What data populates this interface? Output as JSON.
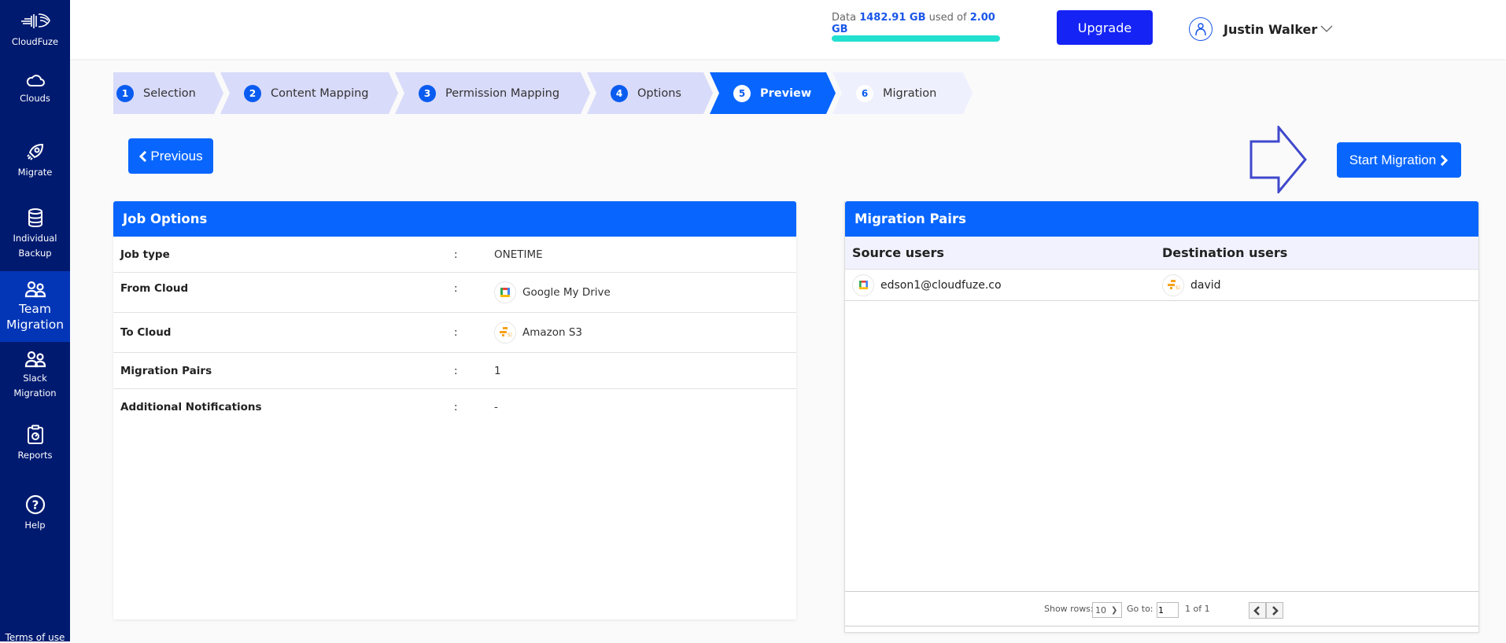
{
  "sidebar": {
    "brand": "CloudFuze",
    "items": [
      {
        "label": "Clouds",
        "icon": "cloud-icon"
      },
      {
        "label": "Migrate",
        "icon": "rocket-icon"
      },
      {
        "label_1": "Individual",
        "label_2": "Backup",
        "icon": "database-icon"
      },
      {
        "label_1": "Team",
        "label_2": "Migration",
        "icon": "users-icon",
        "active": true
      },
      {
        "label_1": "Slack",
        "label_2": "Migration",
        "icon": "users-icon"
      },
      {
        "label": "Reports",
        "icon": "clipboard-icon"
      },
      {
        "label": "Help",
        "icon": "help-icon"
      }
    ],
    "terms": "Terms of use"
  },
  "header": {
    "usage_prefix": "Data",
    "usage_used": "1482.91 GB",
    "usage_mid": "used of",
    "usage_total": "2.00 GB",
    "usage_percent": 100,
    "upgrade_label": "Upgrade",
    "user_name": "Justin Walker"
  },
  "stepper": {
    "steps": [
      {
        "num": "1",
        "label": "Selection",
        "state": "done"
      },
      {
        "num": "2",
        "label": "Content Mapping",
        "state": "done"
      },
      {
        "num": "3",
        "label": "Permission Mapping",
        "state": "done"
      },
      {
        "num": "4",
        "label": "Options",
        "state": "done"
      },
      {
        "num": "5",
        "label": "Preview",
        "state": "active"
      },
      {
        "num": "6",
        "label": "Migration",
        "state": "future"
      }
    ]
  },
  "actions": {
    "previous_label": "Previous",
    "start_label": "Start Migration"
  },
  "job_options": {
    "title": "Job Options",
    "rows": [
      {
        "key": "Job type",
        "value": "ONETIME"
      },
      {
        "key": "From Cloud",
        "value": "Google My Drive",
        "icon": "google-drive-icon"
      },
      {
        "key": "To Cloud",
        "value": "Amazon S3",
        "icon": "amazon-s3-icon"
      },
      {
        "key": "Migration Pairs",
        "value": "1"
      },
      {
        "key": "Additional Notifications",
        "value": "-"
      }
    ],
    "separator": ":"
  },
  "migration_pairs": {
    "title": "Migration Pairs",
    "columns": [
      "Source users",
      "Destination users"
    ],
    "rows": [
      {
        "source": "edson1@cloudfuze.co",
        "destination": "david"
      }
    ],
    "footer": {
      "show_rows_label": "Show rows:",
      "rows_value": "10",
      "goto_label": "Go to:",
      "goto_value": "1",
      "page_info": "1 of 1"
    }
  },
  "colors": {
    "sidebar_bg": "#001a70",
    "sidebar_active": "#0336b6",
    "primary": "#0866ff",
    "upgrade": "#1524f5",
    "step_done": "#d9dbfa",
    "step_future": "#eef0fd",
    "usage_bar": "#22e0d0"
  }
}
